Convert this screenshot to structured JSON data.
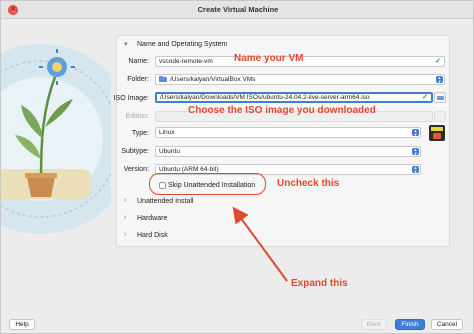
{
  "window": {
    "title": "Create Virtual Machine",
    "close_glyph": "×"
  },
  "sections": {
    "name_os": {
      "label": "Name and Operating System",
      "expanded": true
    },
    "unattended": {
      "label": "Unattended Install",
      "expanded": false
    },
    "hardware": {
      "label": "Hardware",
      "expanded": false
    },
    "hard_disk": {
      "label": "Hard Disk",
      "expanded": false
    }
  },
  "form": {
    "name": {
      "label": "Name:",
      "value": "vscode-remote-vm",
      "valid": true
    },
    "folder": {
      "label": "Folder:",
      "value": "/Users/kalyan/VirtualBox VMs"
    },
    "iso": {
      "label": "ISO Image:",
      "value": "/Users/kalyan/Downloads/VM ISOs/ubuntu-24.04.2-live-server-arm64.iso",
      "valid": true
    },
    "edition": {
      "label": "Edition:",
      "value": "",
      "disabled": true
    },
    "type": {
      "label": "Type:",
      "value": "Linux"
    },
    "subtype": {
      "label": "Subtype:",
      "value": "Ubuntu"
    },
    "version": {
      "label": "Version:",
      "value": "Ubuntu (ARM 64-bit)"
    },
    "skip_unattended": {
      "label": "Skip Unattended Installation",
      "checked": false
    }
  },
  "annotations": {
    "name_vm": "Name your VM",
    "choose_iso": "Choose the ISO image you downloaded",
    "uncheck": "Uncheck this",
    "expand": "Expand this",
    "color": "#e2472f"
  },
  "buttons": {
    "help": "Help",
    "back": "Back",
    "finish": "Finish",
    "cancel": "Cancel"
  },
  "icons": {
    "valid": "checkmark-icon",
    "chevron_down": "chevron-down-icon",
    "chevron_right": "chevron-right-icon",
    "folder": "folder-icon",
    "os": "ubuntu-arm-icon",
    "stepper": "updown-stepper-icon"
  },
  "colors": {
    "accent": "#3d7fd8",
    "valid": "#2a9d3a"
  }
}
